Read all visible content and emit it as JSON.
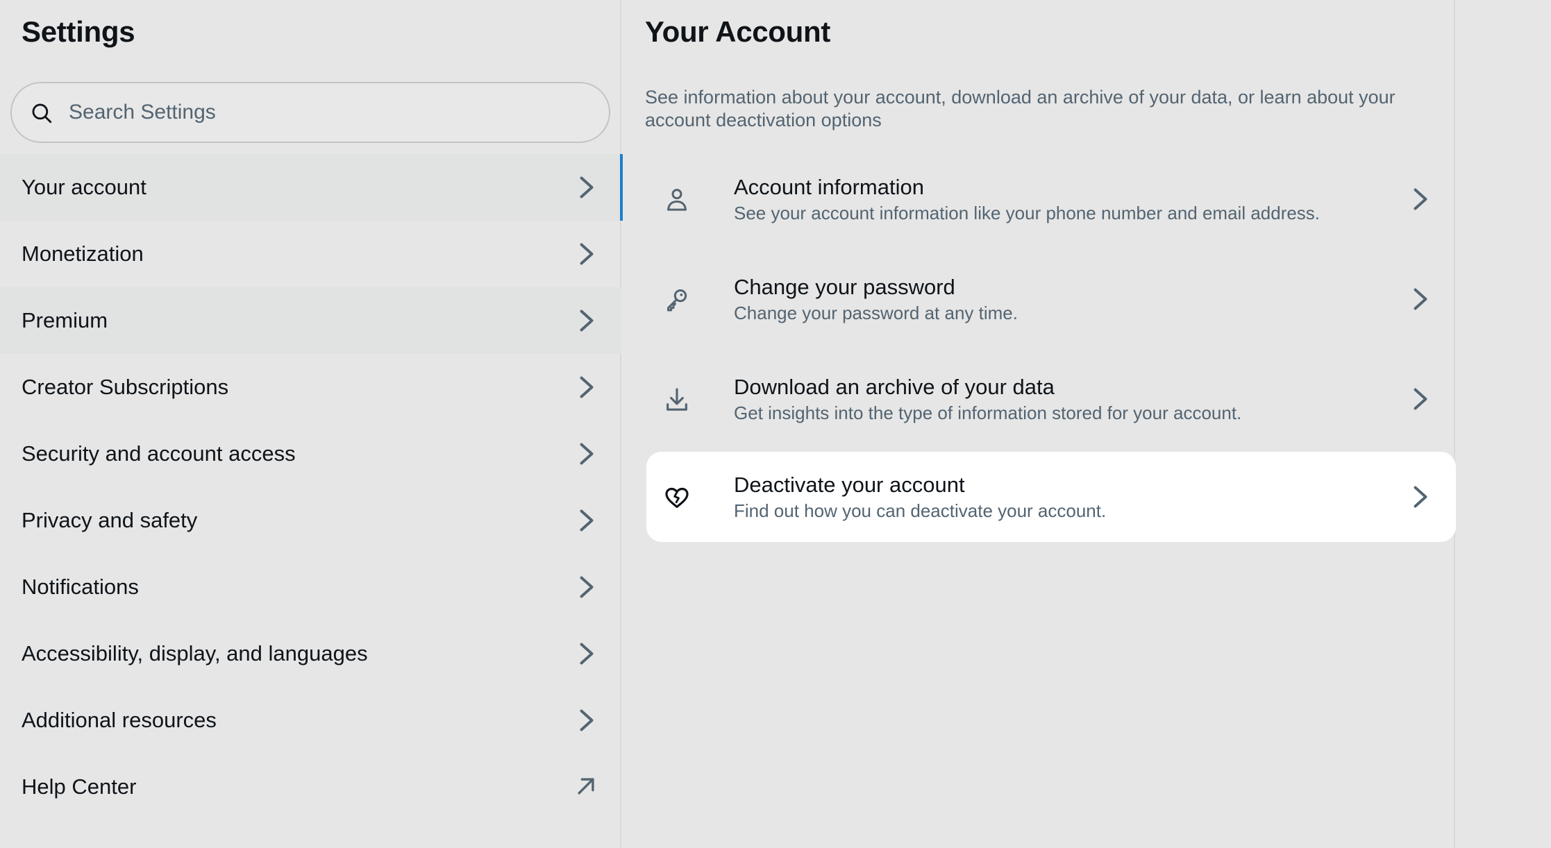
{
  "settings": {
    "title": "Settings",
    "search_placeholder": "Search Settings",
    "items": [
      {
        "label": "Your account"
      },
      {
        "label": "Monetization"
      },
      {
        "label": "Premium"
      },
      {
        "label": "Creator Subscriptions"
      },
      {
        "label": "Security and account access"
      },
      {
        "label": "Privacy and safety"
      },
      {
        "label": "Notifications"
      },
      {
        "label": "Accessibility, display, and languages"
      },
      {
        "label": "Additional resources"
      },
      {
        "label": "Help Center"
      }
    ]
  },
  "account": {
    "title": "Your Account",
    "description": "See information about your account, download an archive of your data, or learn about your account deactivation options",
    "options": [
      {
        "title": "Account information",
        "subtitle": "See your account information like your phone number and email address.",
        "icon": "person-icon"
      },
      {
        "title": "Change your password",
        "subtitle": "Change your password at any time.",
        "icon": "key-icon"
      },
      {
        "title": "Download an archive of your data",
        "subtitle": "Get insights into the type of information stored for your account.",
        "icon": "download-icon"
      },
      {
        "title": "Deactivate your account",
        "subtitle": "Find out how you can deactivate your account.",
        "icon": "broken-heart-icon"
      }
    ]
  },
  "colors": {
    "accent": "#1d7fc9",
    "background": "#e6e6e6",
    "text_primary": "#0f1419",
    "text_secondary": "#536471"
  }
}
